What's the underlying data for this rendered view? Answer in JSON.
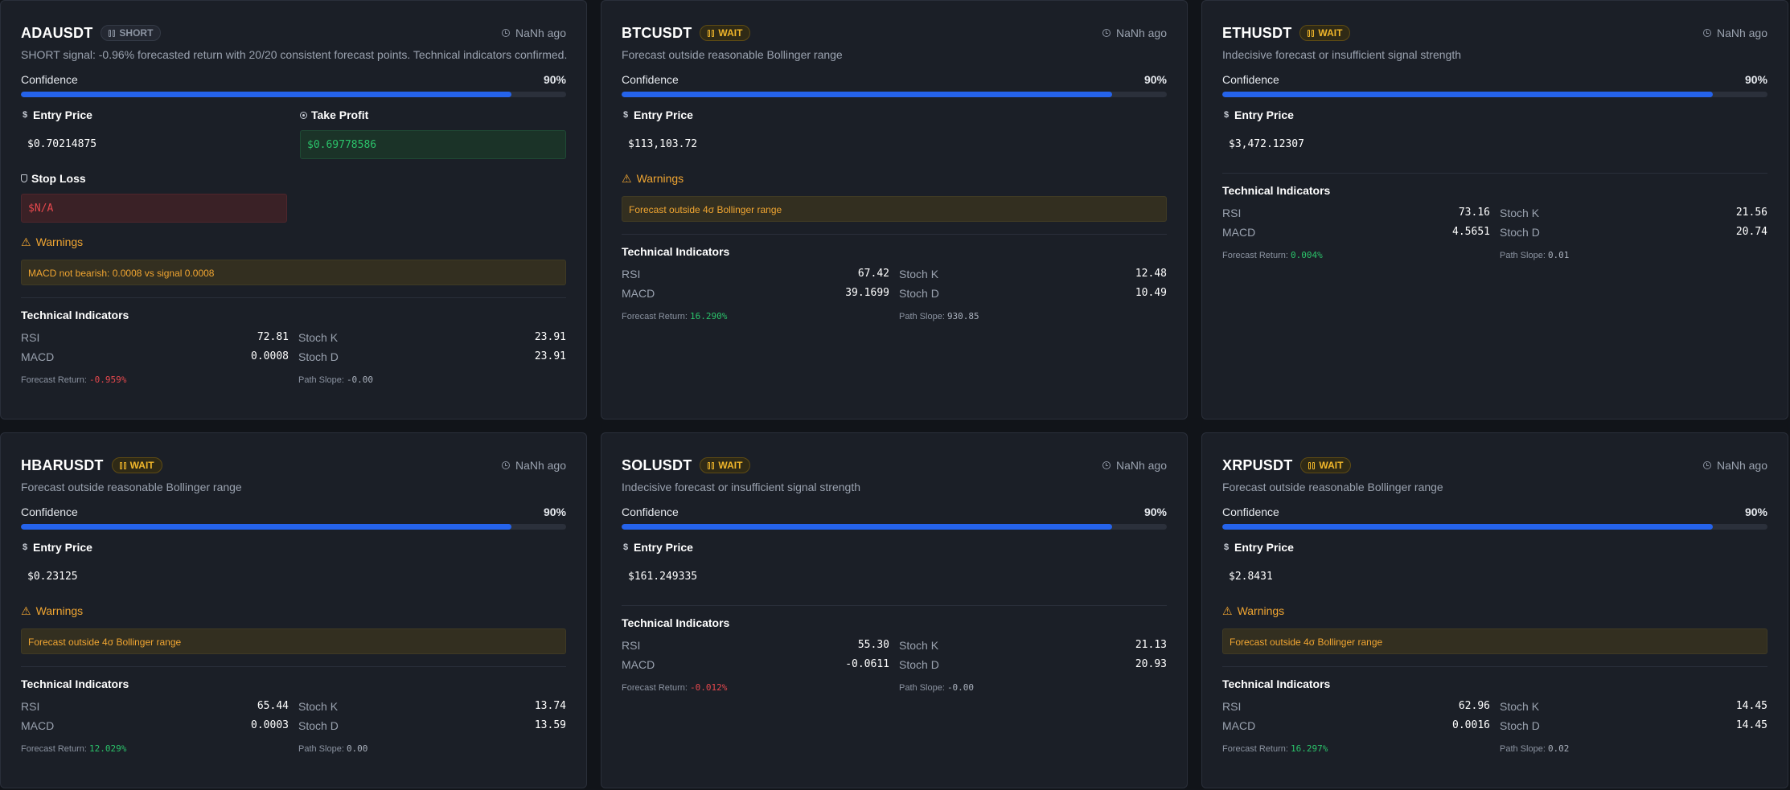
{
  "colors": {
    "accent": "#2563eb",
    "positive": "#2bc26a",
    "negative": "#e5484d",
    "warning": "#f0a531"
  },
  "labels": {
    "confidence": "Confidence",
    "entry_price": "Entry Price",
    "take_profit": "Take Profit",
    "stop_loss": "Stop Loss",
    "warnings": "Warnings",
    "technical_indicators": "Technical Indicators",
    "rsi": "RSI",
    "macd": "MACD",
    "stoch_k": "Stoch K",
    "stoch_d": "Stoch D",
    "forecast_return": "Forecast Return:",
    "path_slope": "Path Slope:"
  },
  "cards": [
    {
      "symbol": "ADAUSDT",
      "badge": "SHORT",
      "badge_type": "short",
      "time": "NaNh ago",
      "description": "SHORT signal: -0.96% forecasted return with 20/20 consistent forecast points. Technical indicators confirmed.",
      "confidence": "90%",
      "confidence_value": 0.9,
      "entry_price": "$0.70214875",
      "take_profit": "$0.69778586",
      "stop_loss": "$N/A",
      "warning": "MACD not bearish: 0.0008 vs signal 0.0008",
      "rsi": "72.81",
      "macd": "0.0008",
      "stoch_k": "23.91",
      "stoch_d": "23.91",
      "forecast_return": "-0.959%",
      "forecast_sign": "neg",
      "path_slope": "-0.00"
    },
    {
      "symbol": "BTCUSDT",
      "badge": "WAIT",
      "badge_type": "wait",
      "time": "NaNh ago",
      "description": "Forecast outside reasonable Bollinger range",
      "confidence": "90%",
      "confidence_value": 0.9,
      "entry_price": "$113,103.72",
      "warning": "Forecast outside 4σ Bollinger range",
      "rsi": "67.42",
      "macd": "39.1699",
      "stoch_k": "12.48",
      "stoch_d": "10.49",
      "forecast_return": "16.290%",
      "forecast_sign": "pos",
      "path_slope": "930.85"
    },
    {
      "symbol": "ETHUSDT",
      "badge": "WAIT",
      "badge_type": "wait",
      "time": "NaNh ago",
      "description": "Indecisive forecast or insufficient signal strength",
      "confidence": "90%",
      "confidence_value": 0.9,
      "entry_price": "$3,472.12307",
      "rsi": "73.16",
      "macd": "4.5651",
      "stoch_k": "21.56",
      "stoch_d": "20.74",
      "forecast_return": "0.004%",
      "forecast_sign": "pos",
      "path_slope": "0.01"
    },
    {
      "symbol": "HBARUSDT",
      "badge": "WAIT",
      "badge_type": "wait",
      "time": "NaNh ago",
      "description": "Forecast outside reasonable Bollinger range",
      "confidence": "90%",
      "confidence_value": 0.9,
      "entry_price": "$0.23125",
      "warning": "Forecast outside 4σ Bollinger range",
      "rsi": "65.44",
      "macd": "0.0003",
      "stoch_k": "13.74",
      "stoch_d": "13.59",
      "forecast_return": "12.029%",
      "forecast_sign": "pos",
      "path_slope": "0.00"
    },
    {
      "symbol": "SOLUSDT",
      "badge": "WAIT",
      "badge_type": "wait",
      "time": "NaNh ago",
      "description": "Indecisive forecast or insufficient signal strength",
      "confidence": "90%",
      "confidence_value": 0.9,
      "entry_price": "$161.249335",
      "rsi": "55.30",
      "macd": "-0.0611",
      "stoch_k": "21.13",
      "stoch_d": "20.93",
      "forecast_return": "-0.012%",
      "forecast_sign": "neg",
      "path_slope": "-0.00"
    },
    {
      "symbol": "XRPUSDT",
      "badge": "WAIT",
      "badge_type": "wait",
      "time": "NaNh ago",
      "description": "Forecast outside reasonable Bollinger range",
      "confidence": "90%",
      "confidence_value": 0.9,
      "entry_price": "$2.8431",
      "warning": "Forecast outside 4σ Bollinger range",
      "rsi": "62.96",
      "macd": "0.0016",
      "stoch_k": "14.45",
      "stoch_d": "14.45",
      "forecast_return": "16.297%",
      "forecast_sign": "pos",
      "path_slope": "0.02"
    }
  ]
}
